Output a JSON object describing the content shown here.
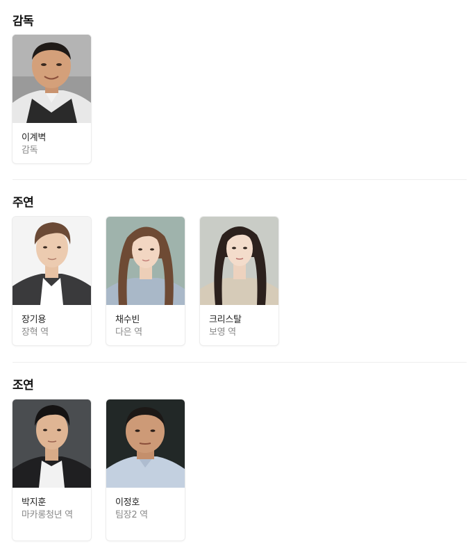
{
  "sections": [
    {
      "title": "감독",
      "people": [
        {
          "name": "이계벽",
          "role": "감독",
          "photo": "director-photo"
        }
      ]
    },
    {
      "title": "주연",
      "people": [
        {
          "name": "장기용",
          "role": "장혁 역",
          "photo": "actor-photo"
        },
        {
          "name": "채수빈",
          "role": "다은 역",
          "photo": "actress-photo"
        },
        {
          "name": "크리스탈",
          "role": "보영 역",
          "photo": "actress-photo"
        }
      ]
    },
    {
      "title": "조연",
      "people": [
        {
          "name": "박지훈",
          "role": "마카롱청년 역",
          "photo": "actor-photo"
        },
        {
          "name": "이정호",
          "role": "팀장2 역",
          "photo": "actor-photo"
        }
      ]
    }
  ]
}
